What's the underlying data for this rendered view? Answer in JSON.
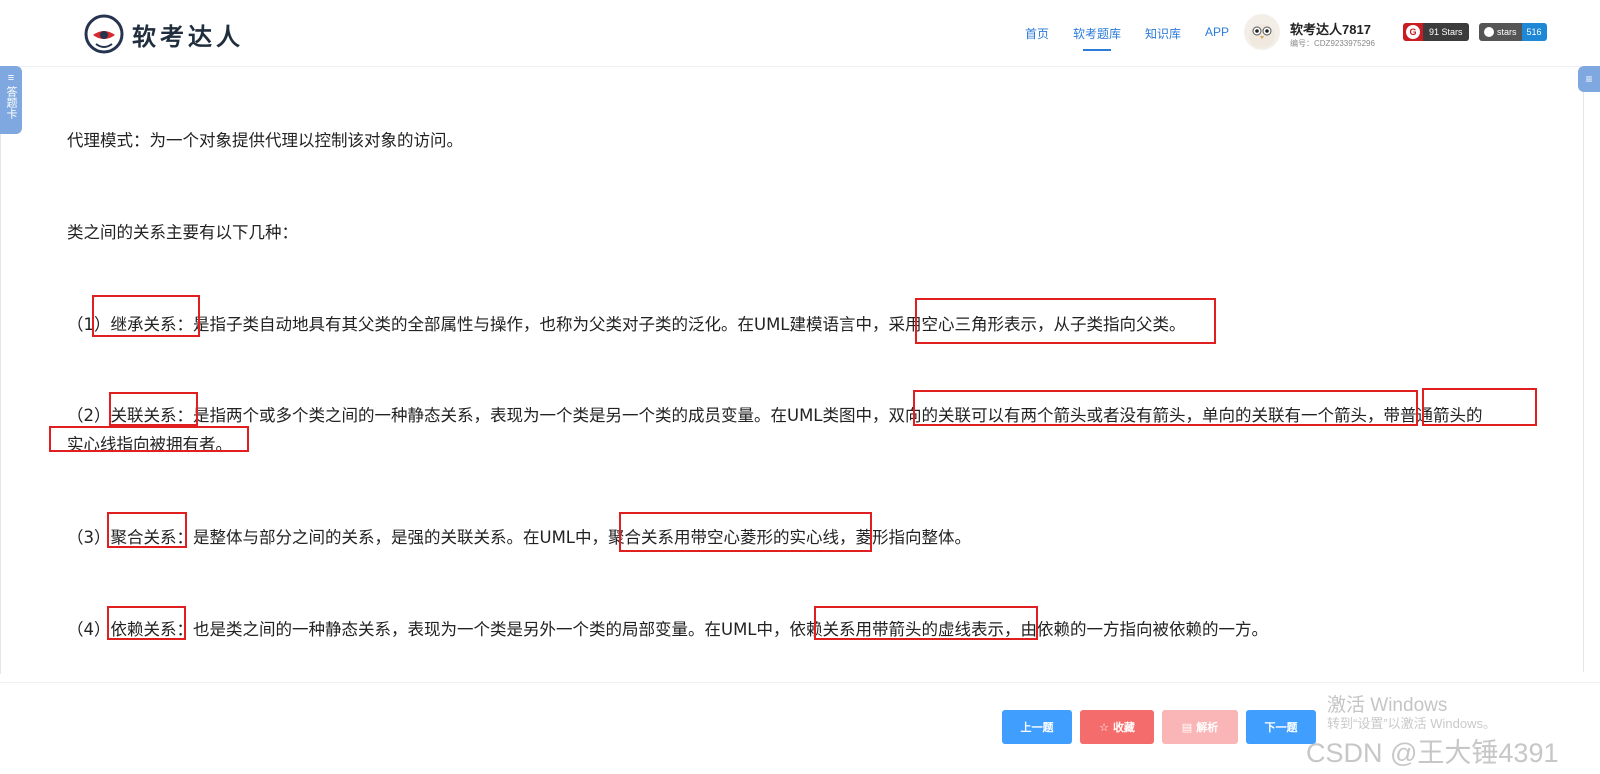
{
  "header": {
    "logo_text": "软考达人",
    "nav": [
      "首页",
      "软考题库",
      "知识库",
      "APP"
    ],
    "active_nav_index": 1,
    "user": {
      "name": "软考达人7817",
      "id": "编号：CDZ9233975296"
    },
    "badges": {
      "gitee_icon": "G",
      "gitee_stars": "91 Stars",
      "github_label": "stars",
      "github_count": "516"
    }
  },
  "side": {
    "left_icon": "≡",
    "left_label": "答题卡",
    "right_icon": "≡"
  },
  "content": {
    "p1": "代理模式：为一个对象提供代理以控制该对象的访问。",
    "p2": "类之间的关系主要有以下几种：",
    "p3": "（1）继承关系：是指子类自动地具有其父类的全部属性与操作，也称为父类对子类的泛化。在UML建模语言中，采用空心三角形表示，从子类指向父类。",
    "p4": "（2）关联关系：是指两个或多个类之间的一种静态关系，表现为一个类是另一个类的成员变量。在UML类图中，双向的关联可以有两个箭头或者没有箭头，单向的关联有一个箭头，带普通箭头的",
    "p4b": "实心线指向被拥有者。",
    "p5": "（3）聚合关系：是整体与部分之间的关系，是强的关联关系。在UML中，聚合关系用带空心菱形的实心线，菱形指向整体。",
    "p6": "（4）依赖关系：也是类之间的一种静态关系，表现为一个类是另外一个类的局部变量。在UML中，依赖关系用带箭头的虚线表示，由依赖的一方指向被依赖的一方。"
  },
  "footer": {
    "prev": "上一题",
    "fav_icon": "☆",
    "fav": "收藏",
    "analysis_icon": "▤",
    "analysis": "解析",
    "next": "下一题"
  },
  "watermark": {
    "activate_title": "激活 Windows",
    "activate_sub": "转到“设置”以激活 Windows。",
    "csdn": "CSDN @王大锤4391"
  },
  "colors": {
    "nav": "#2b7bd8",
    "highlight": "#e02020",
    "primary_button": "#409eff",
    "fav_button": "#f56c6c",
    "analysis_button": "#fab6b6"
  }
}
